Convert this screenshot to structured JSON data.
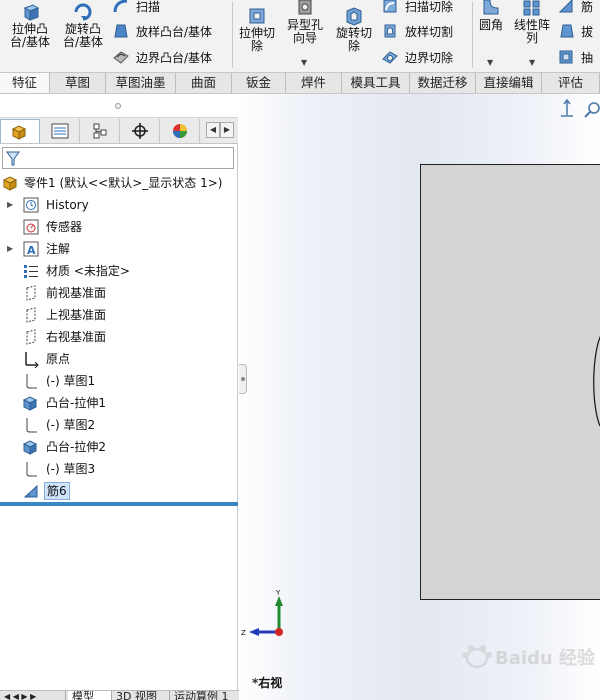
{
  "ribbon": {
    "features_group": {
      "extrude_boss": "拉伸凸\n台/基体",
      "revolve_boss": "旋转凸\n台/基体",
      "sweep": "扫描",
      "loft_boss": "放样凸台/基体",
      "boundary_boss": "边界凸台/基体"
    },
    "cut_group": {
      "extrude_cut": "拉伸切\n除",
      "hole_wizard": "异型孔\n向导",
      "revolve_cut": "旋转切\n除",
      "swept_cut": "扫描切除",
      "lofted_cut": "放样切割",
      "boundary_cut": "边界切除"
    },
    "misc_group": {
      "fillet": "圆角",
      "linear_pattern": "线性阵\n列",
      "rib": "筋",
      "draft": "拔",
      "shell": "抽"
    }
  },
  "command_tabs": [
    {
      "label": "特征",
      "active": true
    },
    {
      "label": "草图",
      "active": false
    },
    {
      "label": "草图油墨",
      "active": false
    },
    {
      "label": "曲面",
      "active": false
    },
    {
      "label": "钣金",
      "active": false
    },
    {
      "label": "焊件",
      "active": false
    },
    {
      "label": "模具工具",
      "active": false
    },
    {
      "label": "数据迁移",
      "active": false
    },
    {
      "label": "直接编辑",
      "active": false
    },
    {
      "label": "评估",
      "active": false
    }
  ],
  "tree": {
    "root": "零件1  (默认<<默认>_显示状态 1>)",
    "items": [
      {
        "label": "History",
        "icon": "history-icon",
        "expandable": true
      },
      {
        "label": "传感器",
        "icon": "sensor-icon",
        "expandable": false
      },
      {
        "label": "注解",
        "icon": "annotation-icon",
        "expandable": true
      },
      {
        "label": "材质 <未指定>",
        "icon": "material-icon",
        "expandable": false
      },
      {
        "label": "前视基准面",
        "icon": "plane-icon",
        "expandable": false
      },
      {
        "label": "上视基准面",
        "icon": "plane-icon",
        "expandable": false
      },
      {
        "label": "右视基准面",
        "icon": "plane-icon",
        "expandable": false
      },
      {
        "label": "原点",
        "icon": "origin-icon",
        "expandable": false
      },
      {
        "label": "(-) 草图1",
        "icon": "sketch-icon",
        "expandable": false
      },
      {
        "label": "凸台-拉伸1",
        "icon": "extrude-feature-icon",
        "expandable": true
      },
      {
        "label": "(-) 草图2",
        "icon": "sketch-icon",
        "expandable": false
      },
      {
        "label": "凸台-拉伸2",
        "icon": "extrude-feature-icon",
        "expandable": true
      },
      {
        "label": "(-) 草图3",
        "icon": "sketch-icon",
        "expandable": false
      },
      {
        "label": "筋6",
        "icon": "rib-icon",
        "expandable": false,
        "selected": true
      }
    ]
  },
  "bottom_tabs": [
    {
      "label": "模型",
      "active": true
    },
    {
      "label": "3D 视图",
      "active": false
    },
    {
      "label": "运动算例 1",
      "active": false
    }
  ],
  "viewport": {
    "view_name": "*右视",
    "triad_y": "Y",
    "triad_z": "Z",
    "watermark": "Baidu 经验"
  },
  "colors": {
    "rollback_bar": "#3a88c4",
    "part_face": "#d4d4d4",
    "selection": "#cfe3fb"
  }
}
